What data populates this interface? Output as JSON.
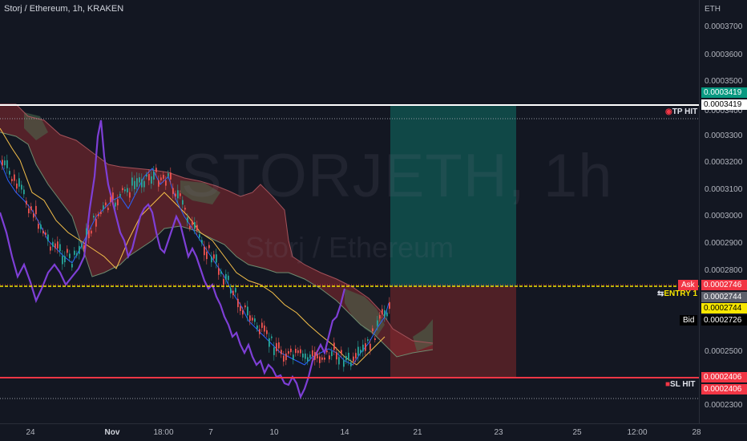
{
  "header": {
    "title": "Storj / Ethereum, 1h, KRAKEN"
  },
  "watermark": {
    "symbol": "STORJETH, 1h",
    "name": "Storj / Ethereum"
  },
  "price_axis": {
    "currency": "ETH",
    "ticks": [
      "0.0003700",
      "0.0003600",
      "0.0003500",
      "0.0003400",
      "0.0003300",
      "0.0003200",
      "0.0003100",
      "0.0003000",
      "0.0002900",
      "0.0002800",
      "0.0002500",
      "0.0002300"
    ]
  },
  "time_axis": {
    "ticks": [
      {
        "label": "24",
        "bold": false
      },
      {
        "label": "Nov",
        "bold": true
      },
      {
        "label": "18:00",
        "bold": false
      },
      {
        "label": "7",
        "bold": false
      },
      {
        "label": "10",
        "bold": false
      },
      {
        "label": "14",
        "bold": false
      },
      {
        "label": "21",
        "bold": false
      },
      {
        "label": "23",
        "bold": false
      },
      {
        "label": "25",
        "bold": false
      },
      {
        "label": "12:00",
        "bold": false
      },
      {
        "label": "28",
        "bold": false
      }
    ]
  },
  "levels": {
    "tp": {
      "label": "TP HIT",
      "price_top": "0.0003419",
      "price_bottom": "0.0003419",
      "color": "#ffffff",
      "tag_color": "#089981"
    },
    "entry": {
      "label": "ENTRY 1",
      "price": "0.0002744",
      "color": "#f7e600"
    },
    "sl": {
      "label": "SL HIT",
      "price_top": "0.0002406",
      "price_bottom": "0.0002406",
      "color": "#f23645"
    },
    "ask": {
      "label": "Ask",
      "price": "0.0002746",
      "color": "#f23645"
    },
    "last": {
      "price": "0.0002744",
      "color": "#5d606b"
    },
    "bid": {
      "label": "Bid",
      "price": "0.0002726",
      "color": "#000000"
    }
  },
  "colors": {
    "background": "#131722",
    "cloud_bear": "#8b2a2f",
    "cloud_bull": "#4b6b4f",
    "conversion": "#2962ff",
    "base": "#f5c04a",
    "lagging": "#7e3fd6",
    "candle_up": "#26a69a",
    "candle_down": "#ef5350",
    "profit_zone": "#0f5c56",
    "loss_zone": "#5b2227"
  }
}
